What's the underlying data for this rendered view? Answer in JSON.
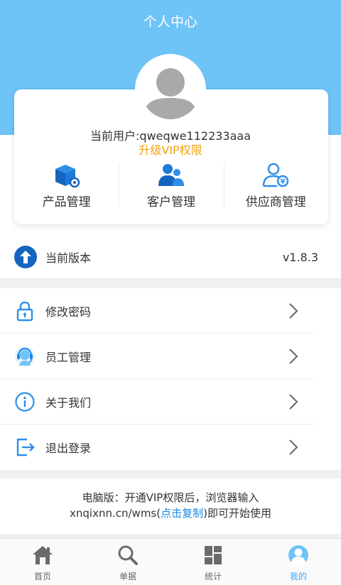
{
  "header": {
    "title": "个人中心"
  },
  "profile": {
    "user_text": "当前用户:qweqwe112233aaa",
    "vip_text": "升级VIP权限"
  },
  "management": [
    {
      "label": "产品管理",
      "icon": "product-box-gear-icon"
    },
    {
      "label": "客户管理",
      "icon": "customers-icon"
    },
    {
      "label": "供应商管理",
      "icon": "supplier-icon"
    }
  ],
  "version": {
    "label": "当前版本",
    "value": "v1.8.3",
    "icon": "upload-arrow-icon"
  },
  "menu": [
    {
      "label": "修改密码",
      "icon": "lock-icon"
    },
    {
      "label": "员工管理",
      "icon": "headset-staff-icon"
    },
    {
      "label": "关于我们",
      "icon": "info-icon"
    },
    {
      "label": "退出登录",
      "icon": "logout-icon"
    }
  ],
  "pc_note": {
    "line1": "电脑版：开通VIP权限后，浏览器输入",
    "line2_prefix": "xnqixnn.cn/wms(",
    "link": "点击复制",
    "line2_suffix": ")即可开始使用"
  },
  "tabs": [
    {
      "label": "首页",
      "icon": "home-icon",
      "active": false
    },
    {
      "label": "单据",
      "icon": "search-icon",
      "active": false
    },
    {
      "label": "统计",
      "icon": "grid-stats-icon",
      "active": false
    },
    {
      "label": "我的",
      "icon": "user-profile-icon",
      "active": true
    }
  ],
  "colors": {
    "header": "#6ec3f7",
    "accent": "#1e88e5",
    "vip": "#f0a314",
    "tab_active": "#3da5f5"
  }
}
